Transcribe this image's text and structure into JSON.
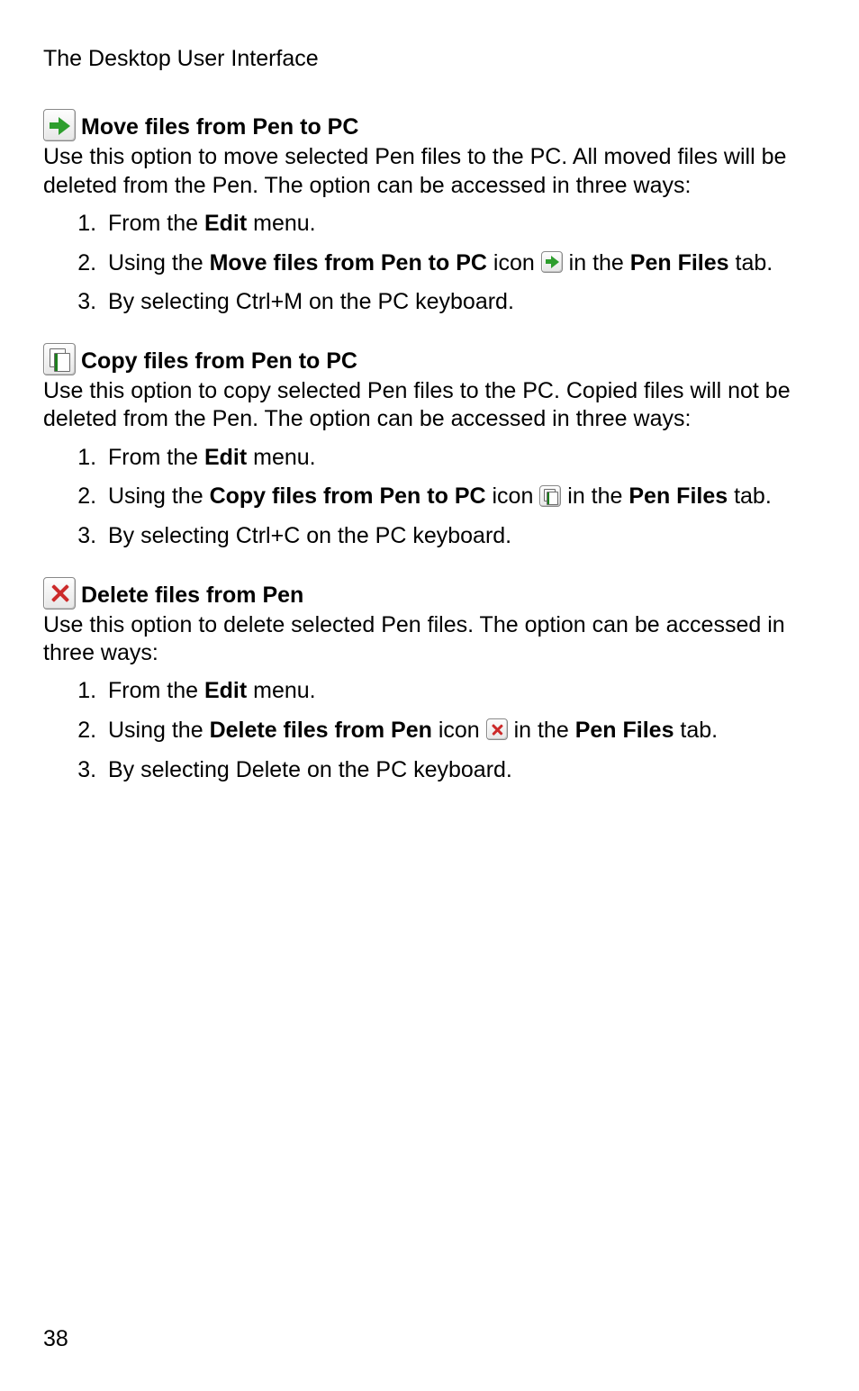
{
  "header": "The Desktop User Interface",
  "page_number": "38",
  "sections": [
    {
      "title": "Move files from Pen to PC",
      "desc": "Use this option to move selected Pen files to the PC. All moved files will be deleted from the Pen. The option can be accessed in three ways:",
      "items": {
        "i1_pre": "From the ",
        "i1_b": "Edit",
        "i1_post": " menu.",
        "i2_pre": "Using the ",
        "i2_b": "Move files from Pen to PC",
        "i2_mid": " icon ",
        "i2_post": " in the ",
        "i2_b2": "Pen Files",
        "i2_end": " tab.",
        "i3": "By selecting Ctrl+M on the PC keyboard."
      }
    },
    {
      "title": "Copy files from Pen to PC",
      "desc": "Use this option to copy selected Pen files to the PC. Copied files will not be deleted from the Pen. The option can be accessed in three ways:",
      "items": {
        "i1_pre": "From the ",
        "i1_b": "Edit",
        "i1_post": " menu.",
        "i2_pre": "Using the ",
        "i2_b": "Copy files from Pen to PC",
        "i2_mid": " icon ",
        "i2_post": " in the ",
        "i2_b2": "Pen Files",
        "i2_end": " tab.",
        "i3": "By selecting Ctrl+C on the PC keyboard."
      }
    },
    {
      "title": "Delete files from Pen",
      "desc": "Use this option to delete selected Pen files. The option can be accessed in three ways:",
      "items": {
        "i1_pre": "From the ",
        "i1_b": "Edit",
        "i1_post": " menu.",
        "i2_pre": "Using the ",
        "i2_b": "Delete files from Pen",
        "i2_mid": " icon ",
        "i2_post": " in the ",
        "i2_b2": "Pen Files",
        "i2_end": " tab.",
        "i3": "By selecting Delete on the PC keyboard."
      }
    }
  ]
}
